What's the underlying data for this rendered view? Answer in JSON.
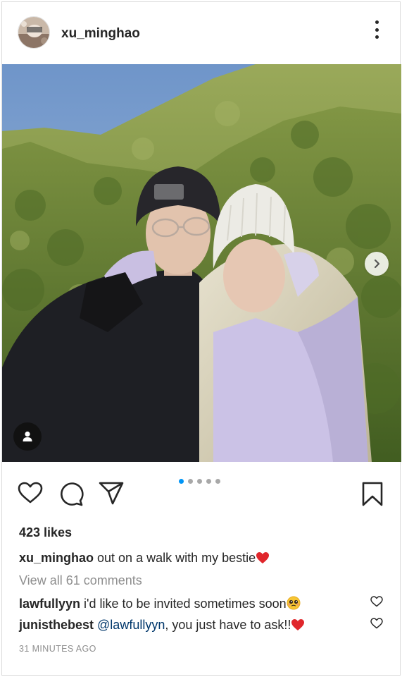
{
  "post": {
    "username": "xu_minghao",
    "likes": "423 likes",
    "caption_user": "xu_minghao",
    "caption_text": " out on a walk with my bestie",
    "caption_emoji": "red-heart-emoji",
    "view_all_comments": "View all 61 comments",
    "comments": [
      {
        "user": "lawfullyyn",
        "text": " i'd like to be invited sometimes soon",
        "emoji": "pleading-face-emoji"
      },
      {
        "user": "junisthebest",
        "mention": "@lawfullyyn",
        "text": ", you just have to ask!!",
        "emoji": "red-heart-emoji"
      }
    ],
    "timestamp": "31 MINUTES AGO",
    "carousel": {
      "count": 5,
      "active_index": 0
    }
  },
  "icons": {
    "options": "more-vertical-icon",
    "like": "heart-outline-icon",
    "comment": "comment-bubble-icon",
    "share": "paper-plane-icon",
    "save": "bookmark-icon",
    "next": "chevron-right-icon",
    "tags": "user-tag-icon"
  },
  "colors": {
    "accent_dot": "#0095f6",
    "heart_red": "#e0262b",
    "mention": "#00376b",
    "muted": "#8e8e8e"
  }
}
